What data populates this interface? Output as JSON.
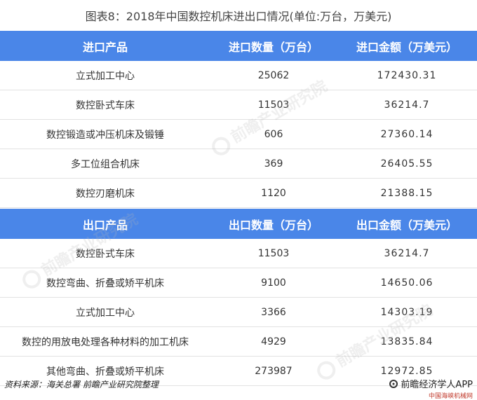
{
  "title": "图表8：2018年中国数控机床进出口情况(单位:万台，万美元)",
  "import_header": {
    "product": "进口产品",
    "quantity": "进口数量（万台）",
    "amount": "进口金额（万美元）"
  },
  "import_rows": [
    {
      "product": "立式加工中心",
      "quantity": "25062",
      "amount": "172430.31"
    },
    {
      "product": "数控卧式车床",
      "quantity": "11503",
      "amount": "36214.7"
    },
    {
      "product": "数控锻造或冲压机床及锻锤",
      "quantity": "606",
      "amount": "27360.14"
    },
    {
      "product": "多工位组合机床",
      "quantity": "369",
      "amount": "26405.55"
    },
    {
      "product": "数控刃磨机床",
      "quantity": "1120",
      "amount": "21388.15"
    }
  ],
  "export_header": {
    "product": "出口产品",
    "quantity": "出口数量（万台）",
    "amount": "出口金额（万美元）"
  },
  "export_rows": [
    {
      "product": "数控卧式车床",
      "quantity": "11503",
      "amount": "36214.7"
    },
    {
      "product": "数控弯曲、折叠或矫平机床",
      "quantity": "9100",
      "amount": "14650.06"
    },
    {
      "product": "立式加工中心",
      "quantity": "3366",
      "amount": "14303.19"
    },
    {
      "product": "数控的用放电处理各种材料的加工机床",
      "quantity": "4929",
      "amount": "13835.84"
    },
    {
      "product": "其他弯曲、折叠或矫平机床",
      "quantity": "273987",
      "amount": "12972.85"
    }
  ],
  "footer": {
    "source": "资料来源：海关总署 前瞻产业研究院整理",
    "brand": "前瞻经济学人APP",
    "brand_sub": "中国海峡机械网"
  },
  "watermark": "前瞻产业研究院",
  "colors": {
    "header_bg": "#4a86e8",
    "header_text": "#ffffff",
    "brand_sub": "#c0392b"
  }
}
